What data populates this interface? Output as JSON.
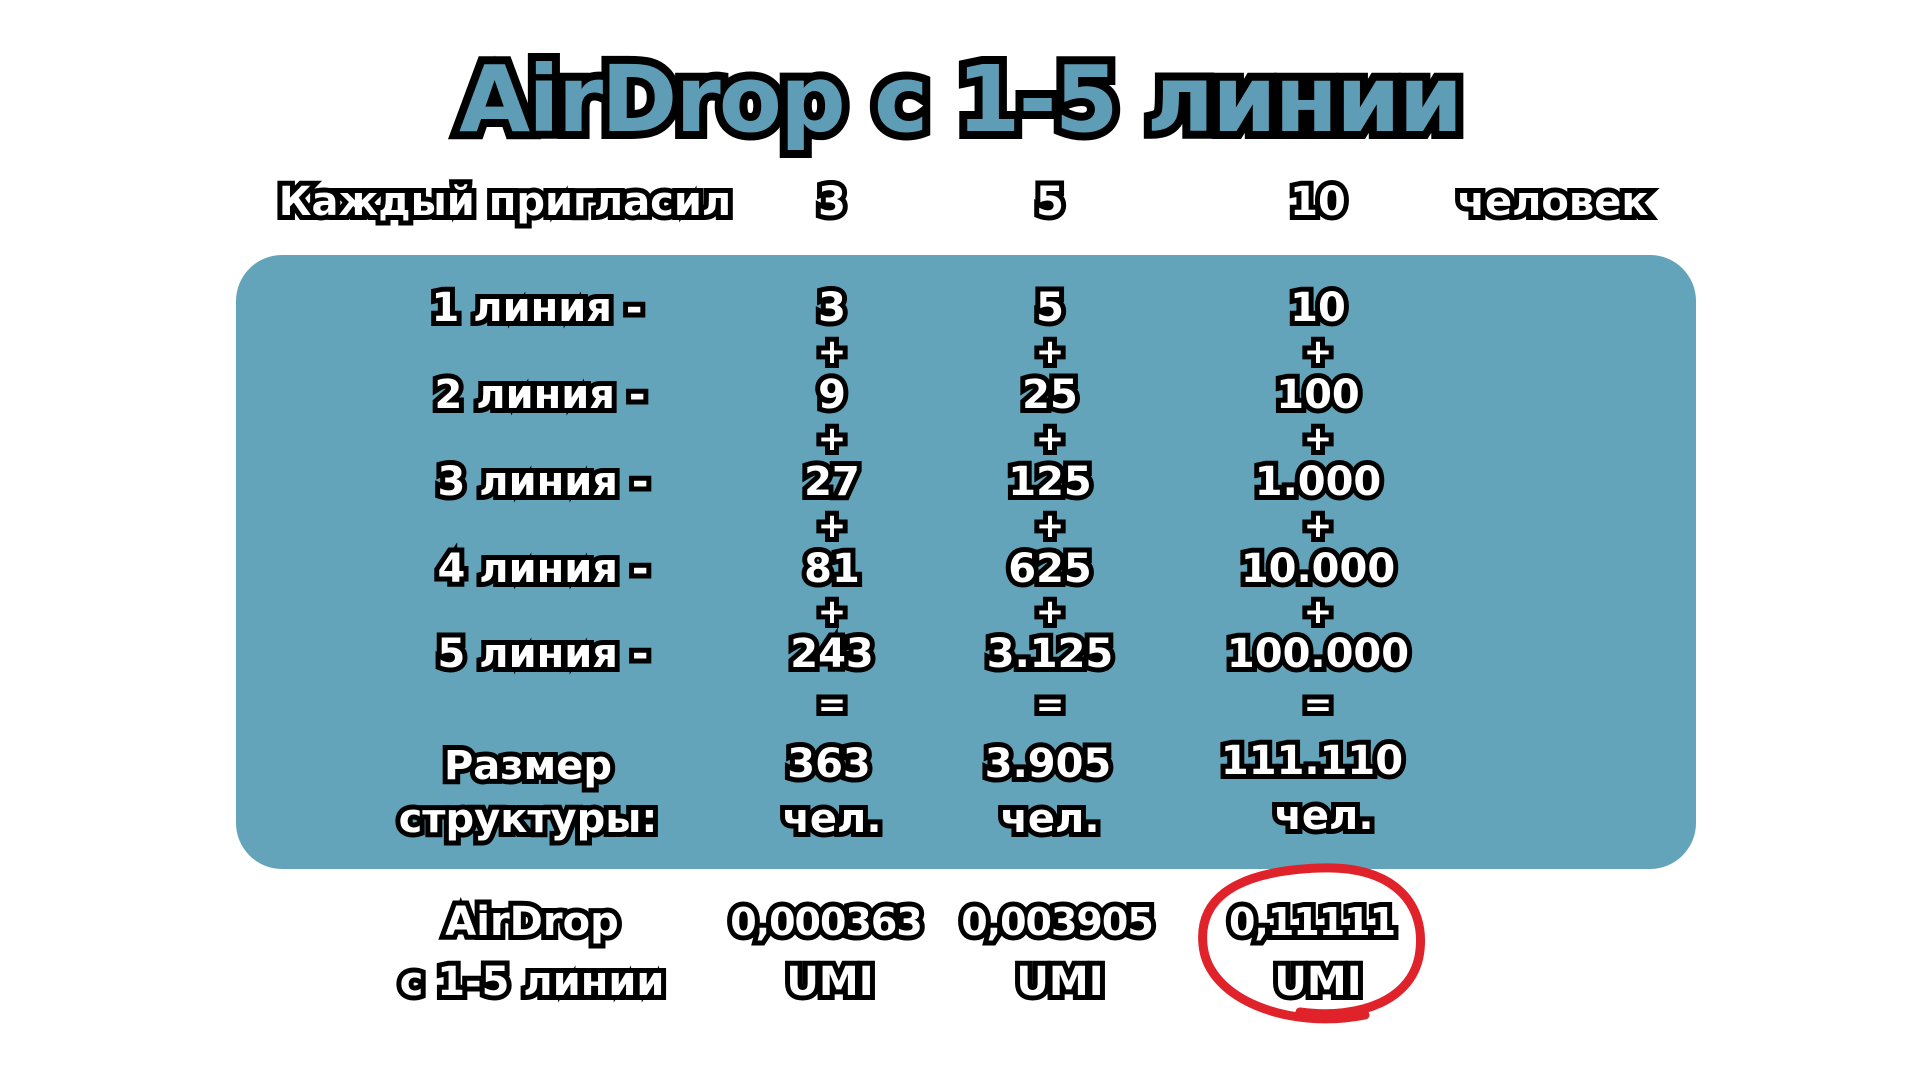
{
  "title": "AirDrop с 1-5 линии",
  "header": {
    "label": "Каждый пригласил",
    "columns": [
      "3",
      "5",
      "10"
    ],
    "unit": "человек"
  },
  "lines": [
    {
      "label": "1 линия -",
      "values": [
        "3",
        "5",
        "10"
      ]
    },
    {
      "label": "2 линия -",
      "values": [
        "9",
        "25",
        "100"
      ]
    },
    {
      "label": "3 линия -",
      "values": [
        "27",
        "125",
        "1.000"
      ]
    },
    {
      "label": "4 линия -",
      "values": [
        "81",
        "625",
        "10.000"
      ]
    },
    {
      "label": "5 линия -",
      "values": [
        "243",
        "3.125",
        "100.000"
      ]
    }
  ],
  "operators": {
    "plus": "+",
    "equals": "="
  },
  "structure": {
    "label_line1": "Размер",
    "label_line2": "структуры:",
    "values": [
      "363",
      "3.905",
      "111.110"
    ],
    "unit": "чел."
  },
  "airdrop": {
    "label_line1": "AirDrop",
    "label_line2": "с 1-5 линии",
    "values": [
      "0,000363",
      "0,003905",
      "0,11111"
    ],
    "unit": "UMI"
  },
  "colors": {
    "panel": "#63a4ba",
    "title_fill": "#5e9db5",
    "highlight_circle": "#e0222b"
  }
}
